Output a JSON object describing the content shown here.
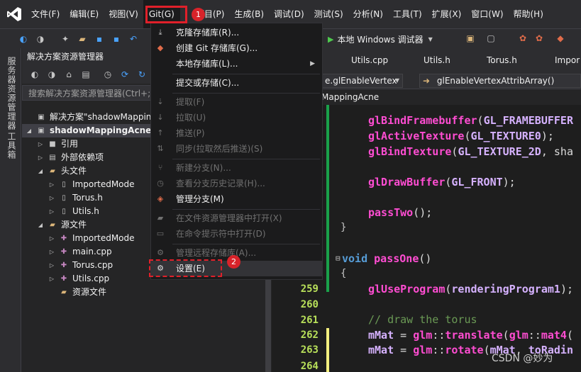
{
  "menubar": {
    "items": [
      {
        "label": "文件(F)"
      },
      {
        "label": "编辑(E)"
      },
      {
        "label": "视图(V)"
      },
      {
        "label": "Git(G)"
      },
      {
        "label": "项目(P)"
      },
      {
        "label": "生成(B)"
      },
      {
        "label": "调试(D)"
      },
      {
        "label": "测试(S)"
      },
      {
        "label": "分析(N)"
      },
      {
        "label": "工具(T)"
      },
      {
        "label": "扩展(X)"
      },
      {
        "label": "窗口(W)"
      },
      {
        "label": "帮助(H)"
      }
    ],
    "badge1": "1",
    "badge2": "2"
  },
  "toolbar": {
    "run_label": "本地 Windows 调试器"
  },
  "left_strip": {
    "tab1": "服务器资源管理器",
    "tab2": "工具箱"
  },
  "solution_explorer": {
    "title": "解决方案资源管理器",
    "search_placeholder": "搜索解决方案资源管理器(Ctrl+;)",
    "tree": [
      {
        "label": "解决方案\"shadowMapping"
      },
      {
        "label": "shadowMappingAcne"
      },
      {
        "label": "引用"
      },
      {
        "label": "外部依赖项"
      },
      {
        "label": "头文件"
      },
      {
        "label": "ImportedMode"
      },
      {
        "label": "Torus.h"
      },
      {
        "label": "Utils.h"
      },
      {
        "label": "源文件"
      },
      {
        "label": "ImportedMode"
      },
      {
        "label": "main.cpp"
      },
      {
        "label": "Torus.cpp"
      },
      {
        "label": "Utils.cpp"
      },
      {
        "label": "资源文件"
      }
    ]
  },
  "editor": {
    "tabs": [
      {
        "label": "Utils.cpp"
      },
      {
        "label": "Utils.h"
      },
      {
        "label": "Torus.h"
      },
      {
        "label": "Impor"
      }
    ],
    "nav_left": "e.glEnableVertex",
    "nav_right": "glEnableVertexAttribArray()",
    "crumb": "MappingAcne",
    "line_numbers": [
      "259",
      "260",
      "261",
      "262",
      "263",
      "264"
    ],
    "code": {
      "l1_fn": "glBindFramebuffer",
      "l1_rest": "(",
      "l1_mac": "GL_FRAMEBUFFER",
      "l2_fn": "glActiveTexture",
      "l2_mac": "GL_TEXTURE0",
      "l2_end": ");",
      "l3_fn": "glBindTexture",
      "l3_mac": "GL_TEXTURE_2D",
      "l3_end": ", sha",
      "l4_fn": "glDrawBuffer",
      "l4_mac": "GL_FRONT",
      "l4_end": ");",
      "l5_fn": "passTwo",
      "l5_end": "();",
      "l6": "}",
      "l7_kw": "void",
      "l7_fn": "passOne",
      "l7_end": "()",
      "l8": "{",
      "l9_fn": "glUseProgram",
      "l9_mac": "renderingProgram1",
      "l9_end": ");",
      "l10_cm": "// draw the torus",
      "l11_a": "mMat",
      "l11_b": " = ",
      "l11_c": "glm",
      "l11_d": "::",
      "l11_e": "translate",
      "l11_f": "(",
      "l11_g": "glm",
      "l11_h": "::",
      "l11_i": "mat4",
      "l11_j": "(",
      "l12_a": "mMat",
      "l12_b": " = ",
      "l12_c": "glm",
      "l12_d": "::",
      "l12_e": "rotate",
      "l12_f": "(",
      "l12_g": "mMat",
      "l12_h": ", ",
      "l12_i": "toRadin"
    }
  },
  "git_menu": {
    "items": [
      {
        "label": "克隆存储库(R)..."
      },
      {
        "label": "创建 Git 存储库(G)..."
      },
      {
        "label": "本地存储库(L)..."
      },
      {
        "label": "提交或存储(C)..."
      },
      {
        "label": "提取(F)"
      },
      {
        "label": "拉取(U)"
      },
      {
        "label": "推送(P)"
      },
      {
        "label": "同步(拉取然后推送)(S)"
      },
      {
        "label": "新建分支(N)..."
      },
      {
        "label": "查看分支历史记录(H)..."
      },
      {
        "label": "管理分支(M)"
      },
      {
        "label": "在文件资源管理器中打开(X)"
      },
      {
        "label": "在命令提示符中打开(D)"
      },
      {
        "label": "管理远程存储库(A)..."
      },
      {
        "label": "设置(E)"
      }
    ]
  },
  "watermark": "CSDN @妙为",
  "colors": {
    "accent_red": "#e0202a",
    "function_pink": "#ff4dd2",
    "macro_purple": "#d6b2ff",
    "keyword_blue": "#569cd6",
    "comment_green": "#6a9955",
    "line_number_green": "#b8e05a"
  }
}
